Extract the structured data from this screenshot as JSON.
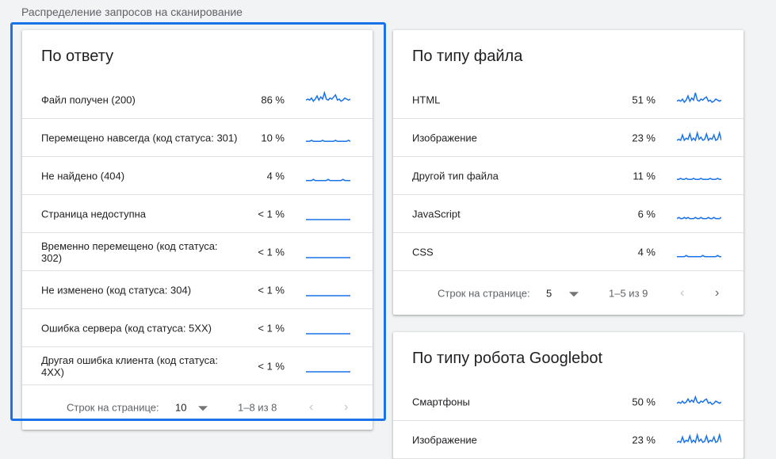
{
  "section_title": "Распределение запросов на сканирование",
  "accent_color": "#1a73e8",
  "spark_color": "#1a73e8",
  "card_response": {
    "title": "По ответу",
    "rows": [
      {
        "label": "Файл получен (200)",
        "pct": "86 %",
        "trend": [
          5,
          6,
          5,
          7,
          4,
          6,
          9,
          5,
          8,
          6,
          12,
          6,
          5,
          7,
          6,
          8,
          10,
          5,
          6,
          4,
          5,
          7,
          6,
          5,
          6
        ]
      },
      {
        "label": "Перемещено навсегда (код статуса: 301)",
        "pct": "10 %",
        "trend": [
          2,
          2,
          2,
          3,
          2,
          2,
          2,
          2,
          2,
          3,
          2,
          2,
          2,
          2,
          2,
          2,
          3,
          2,
          2,
          2,
          2,
          2,
          2,
          3,
          2
        ]
      },
      {
        "label": "Не найдено (404)",
        "pct": "4 %",
        "trend": [
          1,
          1,
          1,
          1,
          2,
          1,
          1,
          1,
          1,
          1,
          1,
          1,
          2,
          1,
          1,
          1,
          1,
          1,
          1,
          1,
          2,
          1,
          1,
          1,
          1
        ]
      },
      {
        "label": "Страница недоступна",
        "pct": "< 1 %",
        "trend": [
          0,
          0,
          0,
          0,
          0,
          0,
          0,
          0,
          0,
          0,
          0,
          0,
          0,
          0,
          0,
          0,
          0,
          0,
          0,
          0,
          0,
          0,
          0,
          0,
          0
        ]
      },
      {
        "label": "Временно перемещено (код статуса: 302)",
        "pct": "< 1 %",
        "trend": [
          0,
          0,
          0,
          0,
          0,
          0,
          0,
          0,
          0,
          0,
          0,
          0,
          0,
          0,
          0,
          0,
          0,
          0,
          0,
          0,
          0,
          0,
          0,
          0,
          0
        ]
      },
      {
        "label": "Не изменено (код статуса: 304)",
        "pct": "< 1 %",
        "trend": [
          0,
          0,
          0,
          0,
          0,
          0,
          0,
          0,
          0,
          0,
          0,
          0,
          0,
          0,
          0,
          0,
          0,
          0,
          0,
          0,
          0,
          0,
          0,
          0,
          0
        ]
      },
      {
        "label": "Ошибка сервера (код статуса: 5XX)",
        "pct": "< 1 %",
        "trend": [
          0,
          0,
          0,
          0,
          0,
          0,
          0,
          0,
          0,
          0,
          0,
          0,
          0,
          0,
          0,
          0,
          0,
          0,
          0,
          0,
          0,
          0,
          0,
          0,
          0
        ]
      },
      {
        "label": "Другая ошибка клиента (код статуса: 4XX)",
        "pct": "< 1 %",
        "trend": [
          0,
          0,
          0,
          0,
          0,
          0,
          0,
          0,
          0,
          0,
          0,
          0,
          0,
          0,
          0,
          0,
          0,
          0,
          0,
          0,
          0,
          0,
          0,
          0,
          0
        ]
      }
    ],
    "pager": {
      "rows_label": "Строк на странице:",
      "page_size": "10",
      "range": "1–8 из 8"
    }
  },
  "card_filetype": {
    "title": "По типу файла",
    "rows": [
      {
        "label": "HTML",
        "pct": "51 %",
        "trend": [
          4,
          5,
          4,
          6,
          3,
          5,
          9,
          4,
          7,
          5,
          12,
          5,
          4,
          6,
          5,
          7,
          8,
          4,
          5,
          3,
          4,
          6,
          5,
          4,
          5
        ]
      },
      {
        "label": "Изображение",
        "pct": "23 %",
        "trend": [
          3,
          4,
          3,
          8,
          3,
          5,
          4,
          9,
          3,
          5,
          3,
          10,
          4,
          6,
          3,
          4,
          9,
          3,
          5,
          4,
          8,
          3,
          4,
          10,
          3
        ]
      },
      {
        "label": "Другой тип файла",
        "pct": "11 %",
        "trend": [
          2,
          2,
          3,
          2,
          2,
          3,
          2,
          2,
          2,
          3,
          2,
          2,
          2,
          3,
          2,
          2,
          2,
          2,
          3,
          2,
          2,
          2,
          3,
          2,
          2
        ]
      },
      {
        "label": "JavaScript",
        "pct": "6 %",
        "trend": [
          1,
          2,
          1,
          1,
          2,
          1,
          2,
          1,
          1,
          1,
          2,
          1,
          1,
          2,
          1,
          1,
          1,
          2,
          1,
          1,
          2,
          1,
          1,
          1,
          2
        ]
      },
      {
        "label": "CSS",
        "pct": "4 %",
        "trend": [
          1,
          1,
          1,
          1,
          1,
          2,
          1,
          1,
          1,
          1,
          1,
          1,
          1,
          1,
          2,
          1,
          1,
          1,
          1,
          1,
          1,
          1,
          2,
          1,
          1
        ]
      }
    ],
    "pager": {
      "rows_label": "Строк на странице:",
      "page_size": "5",
      "range": "1–5 из 9"
    }
  },
  "card_googlebot": {
    "title": "По типу робота Googlebot",
    "rows": [
      {
        "label": "Смартфоны",
        "pct": "50 %",
        "trend": [
          4,
          5,
          4,
          6,
          4,
          5,
          8,
          5,
          7,
          5,
          10,
          5,
          4,
          6,
          5,
          7,
          8,
          4,
          5,
          3,
          4,
          6,
          5,
          4,
          5
        ]
      },
      {
        "label": "Изображение",
        "pct": "23 %",
        "trend": [
          3,
          4,
          3,
          8,
          3,
          5,
          4,
          9,
          3,
          5,
          3,
          10,
          4,
          6,
          3,
          4,
          9,
          3,
          5,
          4,
          8,
          3,
          4,
          10,
          3
        ]
      }
    ]
  }
}
